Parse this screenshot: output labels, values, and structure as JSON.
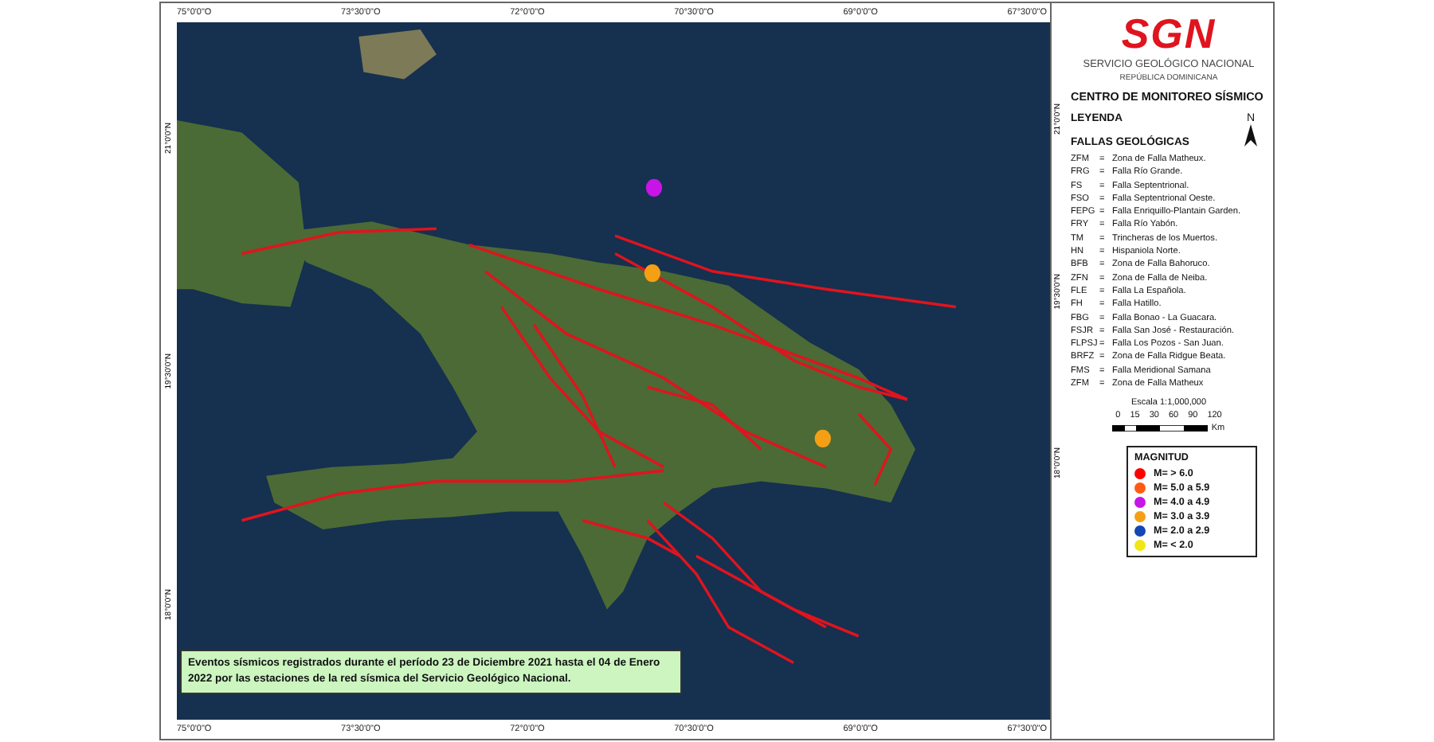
{
  "map": {
    "lon_labels_top": [
      "75°0'0\"O",
      "73°30'0\"O",
      "72°0'0\"O",
      "70°30'0\"O",
      "69°0'0\"O",
      "67°30'0\"O"
    ],
    "lon_labels_bottom": [
      "75°0'0\"O",
      "73°30'0\"O",
      "72°0'0\"O",
      "70°30'0\"O",
      "69°0'0\"O",
      "67°30'0\"O"
    ],
    "lat_labels_left": [
      "21°0'0\"N",
      "19°30'0\"N",
      "18°0'0\"N"
    ],
    "lat_labels_right": [
      "21°0'0\"N",
      "19°30'0\"N",
      "18°0'0\"N"
    ],
    "caption": "Eventos sísmicos registrados durante el período 23 de Diciembre 2021 hasta el 04 de Enero 2022 por las estaciones de la red sísmica del Servicio Geológico Nacional."
  },
  "legend": {
    "logo": "SGN",
    "org": "SERVICIO GEOLÓGICO NACIONAL",
    "country": "REPÚBLICA DOMINICANA",
    "center": "CENTRO DE MONITOREO SÍSMICO",
    "title": "LEYENDA",
    "north": "N",
    "faults_title": "FALLAS GEOLÓGICAS",
    "faults": [
      {
        "code": "ZFM",
        "name": "Zona de Falla Matheux."
      },
      {
        "code": "FRG",
        "name": "Falla Río Grande."
      },
      {
        "code": "FS",
        "name": "Falla Septentrional."
      },
      {
        "code": "FSO",
        "name": "Falla Septentrional Oeste."
      },
      {
        "code": "FEPG",
        "name": "Falla Enriquillo-Plantain Garden."
      },
      {
        "code": "FRY",
        "name": "Falla Río Yabón."
      },
      {
        "code": "TM",
        "name": "Trincheras de los Muertos."
      },
      {
        "code": "HN",
        "name": "Hispaniola Norte."
      },
      {
        "code": "BFB",
        "name": "Zona de Falla Bahoruco."
      },
      {
        "code": "ZFN",
        "name": "Zona de Falla de Neiba."
      },
      {
        "code": "FLE",
        "name": "Falla La Española."
      },
      {
        "code": "FH",
        "name": "Falla Hatillo."
      },
      {
        "code": "FBG",
        "name": "Falla Bonao - La Guacara."
      },
      {
        "code": "FSJR",
        "name": "Falla San José - Restauración."
      },
      {
        "code": "FLPSJ",
        "name": "Falla Los Pozos - San Juan."
      },
      {
        "code": "BRFZ",
        "name": "Zona de Falla Ridgue Beata."
      },
      {
        "code": "FMS",
        "name": "Falla Meridional Samana"
      },
      {
        "code": "ZFM",
        "name": "Zona de Falla Matheux"
      }
    ],
    "separator": "=",
    "scale": "Escala 1:1,000,000",
    "scale_ticks": [
      "0",
      "15",
      "30",
      "60",
      "90",
      "120"
    ],
    "scale_unit": "Km",
    "magnitude_title": "MAGNITUD",
    "magnitudes": [
      {
        "label": "M= > 6.0",
        "color": "#ff0000"
      },
      {
        "label": "M= 5.0 a 5.9",
        "color": "#ff5a14"
      },
      {
        "label": "M= 4.0 a 4.9",
        "color": "#c814e6"
      },
      {
        "label": "M= 3.0 a 3.9",
        "color": "#f5a014"
      },
      {
        "label": "M= 2.0 a 2.9",
        "color": "#1446b4"
      },
      {
        "label": "M= < 2.0",
        "color": "#f0e614"
      }
    ]
  }
}
